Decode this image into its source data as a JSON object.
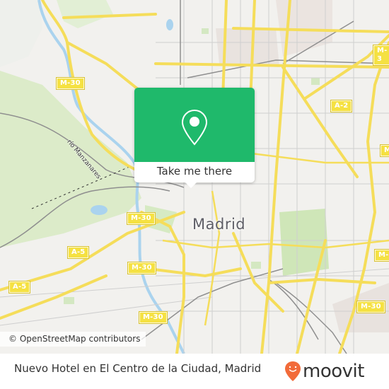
{
  "map": {
    "city_label": "Madrid",
    "river_label": "río Manzanares",
    "road_labels": [
      {
        "id": "m30-nw",
        "text": "M-30"
      },
      {
        "id": "a2",
        "text": "A-2"
      },
      {
        "id": "m30-ne",
        "text": "M-3"
      },
      {
        "id": "m30-e",
        "text": "M"
      },
      {
        "id": "m30-w",
        "text": "M-30"
      },
      {
        "id": "a5-center",
        "text": "A-5"
      },
      {
        "id": "a5-west",
        "text": "A-5"
      },
      {
        "id": "m30-sw",
        "text": "M-30"
      },
      {
        "id": "m30-s",
        "text": "M-30"
      },
      {
        "id": "m30-e2",
        "text": "M-"
      },
      {
        "id": "m30-se",
        "text": "M-30"
      }
    ],
    "attribution": "© OpenStreetMap contributors"
  },
  "popup": {
    "icon": "map-pin-icon",
    "button_label": "Take me there",
    "color": "#1fb96b"
  },
  "footer": {
    "title": "Nuevo Hotel en El Centro de la Ciudad, Madrid",
    "logo_text": "moovit",
    "logo_color": "#f26b3a"
  }
}
